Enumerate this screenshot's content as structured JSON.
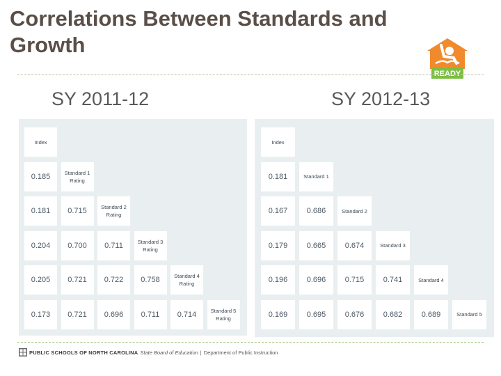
{
  "slide": {
    "title": "Correlations Between Standards and Growth",
    "logo": {
      "icon": "ready-house-reader-icon",
      "label": "READY",
      "colors": {
        "house": "#f08a2c",
        "banner": "#7cbf42"
      }
    },
    "footer": {
      "emblem_icon": "nc-seal-icon",
      "org": "PUBLIC SCHOOLS OF NORTH CAROLINA",
      "sub1": "State Board of Education",
      "separator": "|",
      "sub2": "Department of Public Instruction"
    }
  },
  "panels": [
    {
      "year": "SY 2011-12",
      "labels": [
        "Index",
        "Standard 1 Rating",
        "Standard 2 Rating",
        "Standard 3 Rating",
        "Standard 4 Rating",
        "Standard 5 Rating"
      ],
      "rows": [
        [
          "0.185"
        ],
        [
          "0.181",
          "0.715"
        ],
        [
          "0.204",
          "0.700",
          "0.711"
        ],
        [
          "0.205",
          "0.721",
          "0.722",
          "0.758"
        ],
        [
          "0.173",
          "0.721",
          "0.696",
          "0.711",
          "0.714"
        ]
      ]
    },
    {
      "year": "SY 2012-13",
      "labels": [
        "Index",
        "Standard 1",
        "Standard 2",
        "Standard 3",
        "Standard 4",
        "Standard 5"
      ],
      "rows": [
        [
          "0.181"
        ],
        [
          "0.167",
          "0.686"
        ],
        [
          "0.179",
          "0.665",
          "0.674"
        ],
        [
          "0.196",
          "0.696",
          "0.715",
          "0.741"
        ],
        [
          "0.169",
          "0.695",
          "0.676",
          "0.682",
          "0.689"
        ]
      ]
    }
  ],
  "chart_data": [
    {
      "type": "table",
      "title": "SY 2011-12",
      "variables": [
        "Index",
        "Standard 1 Rating",
        "Standard 2 Rating",
        "Standard 3 Rating",
        "Standard 4 Rating",
        "Standard 5 Rating"
      ],
      "lower_triangle": [
        [
          0.185
        ],
        [
          0.181,
          0.715
        ],
        [
          0.204,
          0.7,
          0.711
        ],
        [
          0.205,
          0.721,
          0.722,
          0.758
        ],
        [
          0.173,
          0.721,
          0.696,
          0.711,
          0.714
        ]
      ]
    },
    {
      "type": "table",
      "title": "SY 2012-13",
      "variables": [
        "Index",
        "Standard 1",
        "Standard 2",
        "Standard 3",
        "Standard 4",
        "Standard 5"
      ],
      "lower_triangle": [
        [
          0.181
        ],
        [
          0.167,
          0.686
        ],
        [
          0.179,
          0.665,
          0.674
        ],
        [
          0.196,
          0.696,
          0.715,
          0.741
        ],
        [
          0.169,
          0.695,
          0.676,
          0.682,
          0.689
        ]
      ]
    }
  ]
}
